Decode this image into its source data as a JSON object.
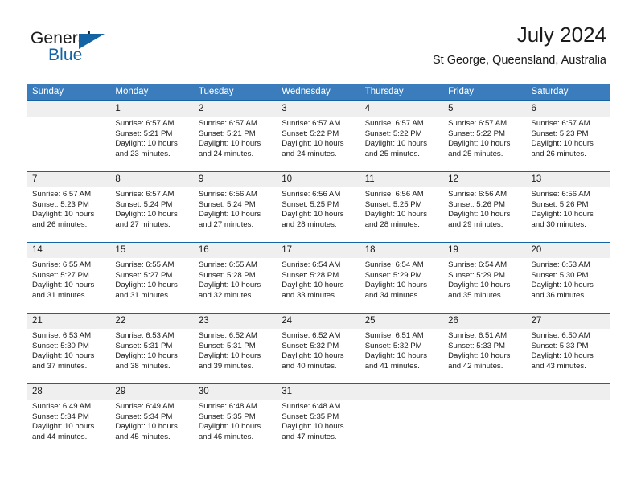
{
  "brand": {
    "name_part1": "General",
    "name_part2": "Blue",
    "accent_color": "#1464a5"
  },
  "header": {
    "month_title": "July 2024",
    "location": "St George, Queensland, Australia"
  },
  "theme": {
    "header_row_bg": "#3b7cbc",
    "week_separator": "#1464a5",
    "day_number_band": "#efefef"
  },
  "weekdays": [
    "Sunday",
    "Monday",
    "Tuesday",
    "Wednesday",
    "Thursday",
    "Friday",
    "Saturday"
  ],
  "weeks": [
    {
      "days": [
        {
          "num": "",
          "lines": [
            "",
            "",
            "",
            ""
          ]
        },
        {
          "num": "1",
          "lines": [
            "Sunrise: 6:57 AM",
            "Sunset: 5:21 PM",
            "Daylight: 10 hours",
            "and 23 minutes."
          ]
        },
        {
          "num": "2",
          "lines": [
            "Sunrise: 6:57 AM",
            "Sunset: 5:21 PM",
            "Daylight: 10 hours",
            "and 24 minutes."
          ]
        },
        {
          "num": "3",
          "lines": [
            "Sunrise: 6:57 AM",
            "Sunset: 5:22 PM",
            "Daylight: 10 hours",
            "and 24 minutes."
          ]
        },
        {
          "num": "4",
          "lines": [
            "Sunrise: 6:57 AM",
            "Sunset: 5:22 PM",
            "Daylight: 10 hours",
            "and 25 minutes."
          ]
        },
        {
          "num": "5",
          "lines": [
            "Sunrise: 6:57 AM",
            "Sunset: 5:22 PM",
            "Daylight: 10 hours",
            "and 25 minutes."
          ]
        },
        {
          "num": "6",
          "lines": [
            "Sunrise: 6:57 AM",
            "Sunset: 5:23 PM",
            "Daylight: 10 hours",
            "and 26 minutes."
          ]
        }
      ]
    },
    {
      "days": [
        {
          "num": "7",
          "lines": [
            "Sunrise: 6:57 AM",
            "Sunset: 5:23 PM",
            "Daylight: 10 hours",
            "and 26 minutes."
          ]
        },
        {
          "num": "8",
          "lines": [
            "Sunrise: 6:57 AM",
            "Sunset: 5:24 PM",
            "Daylight: 10 hours",
            "and 27 minutes."
          ]
        },
        {
          "num": "9",
          "lines": [
            "Sunrise: 6:56 AM",
            "Sunset: 5:24 PM",
            "Daylight: 10 hours",
            "and 27 minutes."
          ]
        },
        {
          "num": "10",
          "lines": [
            "Sunrise: 6:56 AM",
            "Sunset: 5:25 PM",
            "Daylight: 10 hours",
            "and 28 minutes."
          ]
        },
        {
          "num": "11",
          "lines": [
            "Sunrise: 6:56 AM",
            "Sunset: 5:25 PM",
            "Daylight: 10 hours",
            "and 28 minutes."
          ]
        },
        {
          "num": "12",
          "lines": [
            "Sunrise: 6:56 AM",
            "Sunset: 5:26 PM",
            "Daylight: 10 hours",
            "and 29 minutes."
          ]
        },
        {
          "num": "13",
          "lines": [
            "Sunrise: 6:56 AM",
            "Sunset: 5:26 PM",
            "Daylight: 10 hours",
            "and 30 minutes."
          ]
        }
      ]
    },
    {
      "days": [
        {
          "num": "14",
          "lines": [
            "Sunrise: 6:55 AM",
            "Sunset: 5:27 PM",
            "Daylight: 10 hours",
            "and 31 minutes."
          ]
        },
        {
          "num": "15",
          "lines": [
            "Sunrise: 6:55 AM",
            "Sunset: 5:27 PM",
            "Daylight: 10 hours",
            "and 31 minutes."
          ]
        },
        {
          "num": "16",
          "lines": [
            "Sunrise: 6:55 AM",
            "Sunset: 5:28 PM",
            "Daylight: 10 hours",
            "and 32 minutes."
          ]
        },
        {
          "num": "17",
          "lines": [
            "Sunrise: 6:54 AM",
            "Sunset: 5:28 PM",
            "Daylight: 10 hours",
            "and 33 minutes."
          ]
        },
        {
          "num": "18",
          "lines": [
            "Sunrise: 6:54 AM",
            "Sunset: 5:29 PM",
            "Daylight: 10 hours",
            "and 34 minutes."
          ]
        },
        {
          "num": "19",
          "lines": [
            "Sunrise: 6:54 AM",
            "Sunset: 5:29 PM",
            "Daylight: 10 hours",
            "and 35 minutes."
          ]
        },
        {
          "num": "20",
          "lines": [
            "Sunrise: 6:53 AM",
            "Sunset: 5:30 PM",
            "Daylight: 10 hours",
            "and 36 minutes."
          ]
        }
      ]
    },
    {
      "days": [
        {
          "num": "21",
          "lines": [
            "Sunrise: 6:53 AM",
            "Sunset: 5:30 PM",
            "Daylight: 10 hours",
            "and 37 minutes."
          ]
        },
        {
          "num": "22",
          "lines": [
            "Sunrise: 6:53 AM",
            "Sunset: 5:31 PM",
            "Daylight: 10 hours",
            "and 38 minutes."
          ]
        },
        {
          "num": "23",
          "lines": [
            "Sunrise: 6:52 AM",
            "Sunset: 5:31 PM",
            "Daylight: 10 hours",
            "and 39 minutes."
          ]
        },
        {
          "num": "24",
          "lines": [
            "Sunrise: 6:52 AM",
            "Sunset: 5:32 PM",
            "Daylight: 10 hours",
            "and 40 minutes."
          ]
        },
        {
          "num": "25",
          "lines": [
            "Sunrise: 6:51 AM",
            "Sunset: 5:32 PM",
            "Daylight: 10 hours",
            "and 41 minutes."
          ]
        },
        {
          "num": "26",
          "lines": [
            "Sunrise: 6:51 AM",
            "Sunset: 5:33 PM",
            "Daylight: 10 hours",
            "and 42 minutes."
          ]
        },
        {
          "num": "27",
          "lines": [
            "Sunrise: 6:50 AM",
            "Sunset: 5:33 PM",
            "Daylight: 10 hours",
            "and 43 minutes."
          ]
        }
      ]
    },
    {
      "days": [
        {
          "num": "28",
          "lines": [
            "Sunrise: 6:49 AM",
            "Sunset: 5:34 PM",
            "Daylight: 10 hours",
            "and 44 minutes."
          ]
        },
        {
          "num": "29",
          "lines": [
            "Sunrise: 6:49 AM",
            "Sunset: 5:34 PM",
            "Daylight: 10 hours",
            "and 45 minutes."
          ]
        },
        {
          "num": "30",
          "lines": [
            "Sunrise: 6:48 AM",
            "Sunset: 5:35 PM",
            "Daylight: 10 hours",
            "and 46 minutes."
          ]
        },
        {
          "num": "31",
          "lines": [
            "Sunrise: 6:48 AM",
            "Sunset: 5:35 PM",
            "Daylight: 10 hours",
            "and 47 minutes."
          ]
        },
        {
          "num": "",
          "lines": [
            "",
            "",
            "",
            ""
          ]
        },
        {
          "num": "",
          "lines": [
            "",
            "",
            "",
            ""
          ]
        },
        {
          "num": "",
          "lines": [
            "",
            "",
            "",
            ""
          ]
        }
      ]
    }
  ]
}
